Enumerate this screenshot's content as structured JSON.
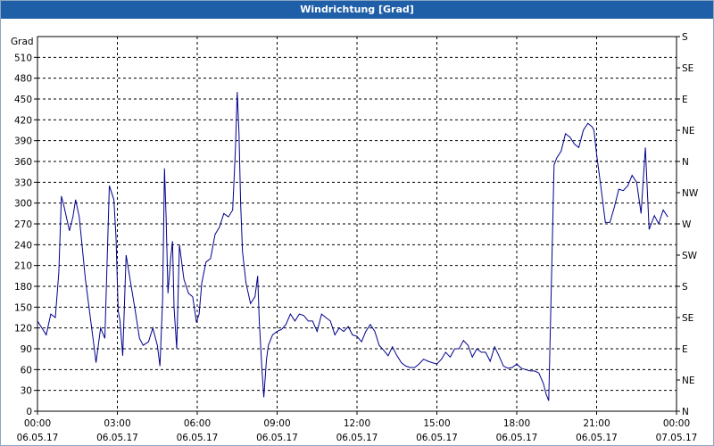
{
  "window_title": "Windrichtung [Grad]",
  "chart_data": {
    "type": "line",
    "title": "Windrichtung [Grad]",
    "ylabel": "Grad",
    "xlabel": "",
    "ylim": [
      0,
      540
    ],
    "yticks": [
      0,
      30,
      60,
      90,
      120,
      150,
      180,
      210,
      240,
      270,
      300,
      330,
      360,
      390,
      420,
      450,
      480,
      510
    ],
    "right_axis_labels": [
      "N",
      "NE",
      "E",
      "SE",
      "S",
      "SW",
      "W",
      "NW",
      "N",
      "NE",
      "E",
      "SE",
      "S"
    ],
    "x_ticks": [
      {
        "time": "00:00",
        "date": "06.05.17"
      },
      {
        "time": "03:00",
        "date": "06.05.17"
      },
      {
        "time": "06:00",
        "date": "06.05.17"
      },
      {
        "time": "09:00",
        "date": "06.05.17"
      },
      {
        "time": "12:00",
        "date": "06.05.17"
      },
      {
        "time": "15:00",
        "date": "06.05.17"
      },
      {
        "time": "18:00",
        "date": "06.05.17"
      },
      {
        "time": "21:00",
        "date": "06.05.17"
      },
      {
        "time": "00:00",
        "date": "07.05.17"
      }
    ],
    "xlim_hours": [
      0,
      24
    ],
    "grid": true,
    "series": [
      {
        "color": "#00008b",
        "points": [
          [
            0.0,
            130
          ],
          [
            0.33,
            110
          ],
          [
            0.5,
            140
          ],
          [
            0.67,
            135
          ],
          [
            0.8,
            200
          ],
          [
            0.9,
            310
          ],
          [
            1.0,
            295
          ],
          [
            1.2,
            260
          ],
          [
            1.33,
            280
          ],
          [
            1.43,
            305
          ],
          [
            1.57,
            280
          ],
          [
            1.8,
            190
          ],
          [
            2.0,
            130
          ],
          [
            2.1,
            100
          ],
          [
            2.2,
            70
          ],
          [
            2.37,
            120
          ],
          [
            2.53,
            105
          ],
          [
            2.7,
            325
          ],
          [
            2.87,
            305
          ],
          [
            2.95,
            250
          ],
          [
            3.03,
            145
          ],
          [
            3.1,
            130
          ],
          [
            3.2,
            80
          ],
          [
            3.33,
            225
          ],
          [
            3.5,
            185
          ],
          [
            3.67,
            145
          ],
          [
            3.83,
            105
          ],
          [
            3.97,
            95
          ],
          [
            4.17,
            100
          ],
          [
            4.33,
            120
          ],
          [
            4.5,
            95
          ],
          [
            4.6,
            65
          ],
          [
            4.7,
            160
          ],
          [
            4.77,
            350
          ],
          [
            4.83,
            280
          ],
          [
            4.9,
            170
          ],
          [
            5.0,
            220
          ],
          [
            5.07,
            245
          ],
          [
            5.13,
            150
          ],
          [
            5.23,
            90
          ],
          [
            5.33,
            240
          ],
          [
            5.5,
            190
          ],
          [
            5.67,
            170
          ],
          [
            5.83,
            165
          ],
          [
            5.97,
            128
          ],
          [
            6.07,
            140
          ],
          [
            6.17,
            185
          ],
          [
            6.33,
            215
          ],
          [
            6.5,
            220
          ],
          [
            6.67,
            255
          ],
          [
            6.83,
            265
          ],
          [
            7.0,
            285
          ],
          [
            7.17,
            280
          ],
          [
            7.33,
            290
          ],
          [
            7.43,
            375
          ],
          [
            7.5,
            460
          ],
          [
            7.57,
            400
          ],
          [
            7.63,
            300
          ],
          [
            7.7,
            230
          ],
          [
            7.83,
            185
          ],
          [
            8.0,
            155
          ],
          [
            8.17,
            165
          ],
          [
            8.27,
            195
          ],
          [
            8.33,
            130
          ],
          [
            8.43,
            60
          ],
          [
            8.5,
            20
          ],
          [
            8.6,
            75
          ],
          [
            8.67,
            95
          ],
          [
            8.83,
            110
          ],
          [
            9.0,
            115
          ],
          [
            9.17,
            118
          ],
          [
            9.33,
            125
          ],
          [
            9.5,
            140
          ],
          [
            9.67,
            130
          ],
          [
            9.83,
            140
          ],
          [
            10.0,
            138
          ],
          [
            10.17,
            130
          ],
          [
            10.33,
            130
          ],
          [
            10.5,
            115
          ],
          [
            10.67,
            140
          ],
          [
            10.83,
            135
          ],
          [
            11.0,
            130
          ],
          [
            11.17,
            110
          ],
          [
            11.33,
            120
          ],
          [
            11.5,
            115
          ],
          [
            11.67,
            122
          ],
          [
            11.83,
            110
          ],
          [
            12.0,
            108
          ],
          [
            12.17,
            100
          ],
          [
            12.33,
            115
          ],
          [
            12.5,
            125
          ],
          [
            12.67,
            115
          ],
          [
            12.83,
            95
          ],
          [
            13.0,
            88
          ],
          [
            13.17,
            80
          ],
          [
            13.33,
            93
          ],
          [
            13.5,
            80
          ],
          [
            13.67,
            70
          ],
          [
            13.83,
            65
          ],
          [
            14.0,
            63
          ],
          [
            14.17,
            63
          ],
          [
            14.33,
            68
          ],
          [
            14.5,
            75
          ],
          [
            14.67,
            72
          ],
          [
            14.83,
            70
          ],
          [
            15.0,
            68
          ],
          [
            15.17,
            75
          ],
          [
            15.33,
            85
          ],
          [
            15.5,
            78
          ],
          [
            15.67,
            90
          ],
          [
            15.83,
            90
          ],
          [
            16.0,
            102
          ],
          [
            16.17,
            95
          ],
          [
            16.33,
            78
          ],
          [
            16.5,
            90
          ],
          [
            16.67,
            85
          ],
          [
            16.83,
            85
          ],
          [
            17.0,
            72
          ],
          [
            17.17,
            93
          ],
          [
            17.33,
            80
          ],
          [
            17.5,
            65
          ],
          [
            17.67,
            62
          ],
          [
            17.83,
            63
          ],
          [
            18.0,
            68
          ],
          [
            18.17,
            62
          ],
          [
            18.33,
            60
          ],
          [
            18.5,
            58
          ],
          [
            18.67,
            58
          ],
          [
            18.83,
            55
          ],
          [
            19.0,
            40
          ],
          [
            19.1,
            25
          ],
          [
            19.2,
            15
          ],
          [
            19.33,
            235
          ],
          [
            19.4,
            355
          ],
          [
            19.5,
            365
          ],
          [
            19.67,
            375
          ],
          [
            19.83,
            400
          ],
          [
            20.0,
            395
          ],
          [
            20.17,
            385
          ],
          [
            20.33,
            380
          ],
          [
            20.5,
            405
          ],
          [
            20.67,
            415
          ],
          [
            20.83,
            410
          ],
          [
            20.9,
            405
          ],
          [
            21.0,
            370
          ],
          [
            21.17,
            320
          ],
          [
            21.33,
            272
          ],
          [
            21.5,
            272
          ],
          [
            21.67,
            295
          ],
          [
            21.83,
            320
          ],
          [
            22.0,
            318
          ],
          [
            22.17,
            325
          ],
          [
            22.33,
            340
          ],
          [
            22.5,
            330
          ],
          [
            22.67,
            285
          ],
          [
            22.83,
            380
          ],
          [
            22.97,
            262
          ],
          [
            23.17,
            282
          ],
          [
            23.33,
            270
          ],
          [
            23.5,
            290
          ],
          [
            23.67,
            280
          ]
        ]
      }
    ]
  }
}
